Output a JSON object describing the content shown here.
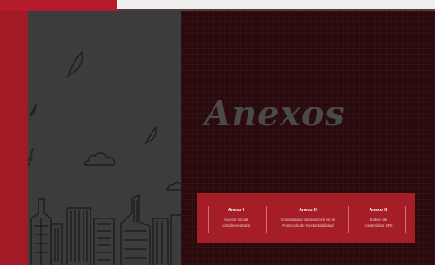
{
  "page": {
    "title": "Anexos"
  },
  "annexes": [
    {
      "heading": "Anexo I",
      "line1": "Acción social",
      "line2": "complementaria"
    },
    {
      "heading": "Anexo II",
      "line1": "Consolidado de avances en el",
      "line2": "Protocolo de Sustentabilidad"
    },
    {
      "heading": "Anexo III",
      "line1": "Índice de",
      "line2": "contenidos GRI"
    }
  ],
  "colors": {
    "accent_red": "#a51d27",
    "dark_bg": "#2a0a0d",
    "left_panel": "#3c3c3e"
  },
  "icons": [
    "leaf-icon",
    "cloud-icon",
    "city-skyline-icon"
  ]
}
